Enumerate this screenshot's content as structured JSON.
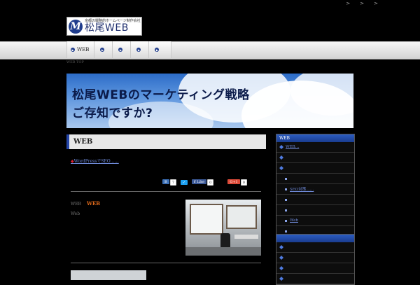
{
  "toplinks": [
    ">",
    ">",
    ">"
  ],
  "logo": {
    "tagline": "京都の戦略的ホームページ制作会社",
    "name": "松尾WEB",
    "mark": "M"
  },
  "nav": {
    "items": [
      "WEB",
      "",
      "",
      "",
      ""
    ]
  },
  "breadcrumb": "WEB TOP",
  "banner": {
    "line1": "松尾WEBのマーケティング戦略",
    "line2": "ご存知ですか?"
  },
  "main": {
    "heading": "WEB",
    "link_marker": "◆",
    "link_text": "WordPressでSEO……",
    "share": {
      "count1": "7",
      "like_label": "Like",
      "count2": "0",
      "gplus_label": "G+1",
      "count3": "0"
    },
    "article": {
      "prefix": "WEB",
      "title": "WEB",
      "sub": "Web"
    }
  },
  "sidebar": {
    "box1": {
      "heading": "WEB",
      "rows": [
        {
          "text": "WEB…",
          "level": 0
        },
        {
          "text": "",
          "level": 0
        },
        {
          "text": "",
          "level": 0
        },
        {
          "text": "",
          "level": 1
        },
        {
          "text": "SEO対策……",
          "level": 1
        },
        {
          "text": "",
          "level": 1
        },
        {
          "text": "",
          "level": 1
        },
        {
          "text": "Web",
          "level": 1
        },
        {
          "text": "",
          "level": 1
        }
      ]
    },
    "box2": {
      "heading": "",
      "rows": [
        {
          "text": "",
          "level": 0
        },
        {
          "text": "",
          "level": 0
        },
        {
          "text": "",
          "level": 0
        },
        {
          "text": "",
          "level": 0
        }
      ]
    }
  },
  "colors": {
    "accent": "#2445a8",
    "nav_bg": "#e0e0e0",
    "link": "#6f8ad8",
    "orange": "#e06a1b"
  }
}
